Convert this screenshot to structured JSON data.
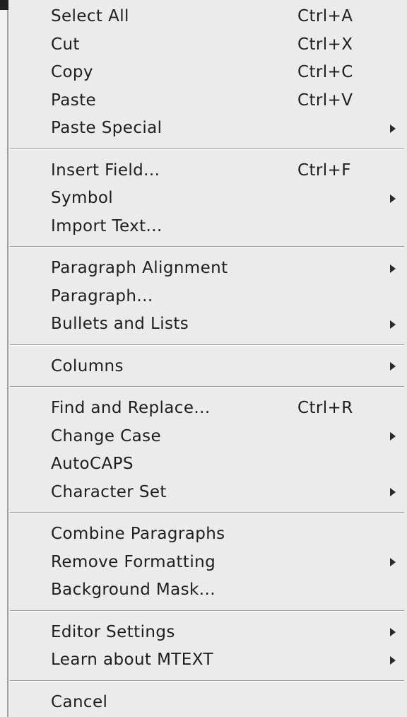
{
  "menu": {
    "groups": [
      {
        "items": [
          {
            "label": "Select All",
            "shortcut": "Ctrl+A",
            "submenu": false
          },
          {
            "label": "Cut",
            "shortcut": "Ctrl+X",
            "submenu": false
          },
          {
            "label": "Copy",
            "shortcut": "Ctrl+C",
            "submenu": false
          },
          {
            "label": "Paste",
            "shortcut": "Ctrl+V",
            "submenu": false
          },
          {
            "label": "Paste Special",
            "shortcut": "",
            "submenu": true
          }
        ]
      },
      {
        "items": [
          {
            "label": "Insert Field...",
            "shortcut": "Ctrl+F",
            "submenu": false
          },
          {
            "label": "Symbol",
            "shortcut": "",
            "submenu": true
          },
          {
            "label": "Import Text...",
            "shortcut": "",
            "submenu": false
          }
        ]
      },
      {
        "items": [
          {
            "label": "Paragraph Alignment",
            "shortcut": "",
            "submenu": true
          },
          {
            "label": "Paragraph...",
            "shortcut": "",
            "submenu": false
          },
          {
            "label": "Bullets and Lists",
            "shortcut": "",
            "submenu": true
          }
        ]
      },
      {
        "items": [
          {
            "label": "Columns",
            "shortcut": "",
            "submenu": true
          }
        ]
      },
      {
        "items": [
          {
            "label": "Find and Replace...",
            "shortcut": "Ctrl+R",
            "submenu": false
          },
          {
            "label": "Change Case",
            "shortcut": "",
            "submenu": true
          },
          {
            "label": "AutoCAPS",
            "shortcut": "",
            "submenu": false
          },
          {
            "label": "Character Set",
            "shortcut": "",
            "submenu": true
          }
        ]
      },
      {
        "items": [
          {
            "label": "Combine Paragraphs",
            "shortcut": "",
            "submenu": false
          },
          {
            "label": "Remove Formatting",
            "shortcut": "",
            "submenu": true
          },
          {
            "label": "Background Mask...",
            "shortcut": "",
            "submenu": false
          }
        ]
      },
      {
        "items": [
          {
            "label": "Editor Settings",
            "shortcut": "",
            "submenu": true
          },
          {
            "label": "Learn about MTEXT",
            "shortcut": "",
            "submenu": true
          }
        ]
      },
      {
        "items": [
          {
            "label": "Cancel",
            "shortcut": "",
            "submenu": false
          }
        ]
      }
    ]
  },
  "colors": {
    "menu_background": "#ebebeb",
    "text": "#1e1e1e",
    "separator_dark": "#9a9a9a",
    "separator_light": "#ffffff"
  }
}
